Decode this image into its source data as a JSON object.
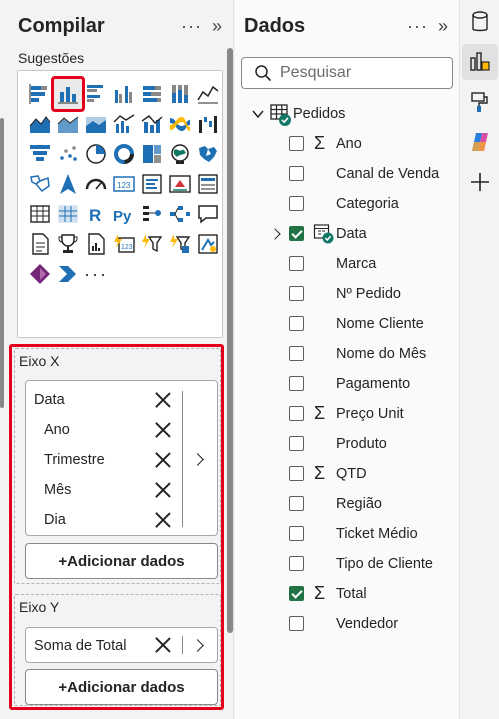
{
  "build_pane": {
    "title": "Compilar",
    "more_glyph": "···",
    "collapse_glyph": "»",
    "suggestions_label": "Sugestões",
    "more_visuals_glyph": "···",
    "x_axis": {
      "label": "Eixo X",
      "fields": [
        "Data",
        "Ano",
        "Trimestre",
        "Mês",
        "Dia"
      ],
      "add_label": "+Adicionar dados"
    },
    "y_axis": {
      "label": "Eixo Y",
      "fields": [
        "Soma de Total"
      ],
      "add_label": "+Adicionar dados"
    }
  },
  "data_pane": {
    "title": "Dados",
    "more_glyph": "···",
    "collapse_glyph": "»",
    "search_placeholder": "Pesquisar",
    "table_name": "Pedidos",
    "fields": [
      {
        "name": "Ano",
        "sigma": true,
        "checked": false
      },
      {
        "name": "Canal de Venda",
        "sigma": false,
        "checked": false
      },
      {
        "name": "Categoria",
        "sigma": false,
        "checked": false
      },
      {
        "name": "Data",
        "sigma": false,
        "checked": true,
        "hierarchy": true
      },
      {
        "name": "Marca",
        "sigma": false,
        "checked": false
      },
      {
        "name": "Nº Pedido",
        "sigma": false,
        "checked": false
      },
      {
        "name": "Nome Cliente",
        "sigma": false,
        "checked": false
      },
      {
        "name": "Nome do Mês",
        "sigma": false,
        "checked": false
      },
      {
        "name": "Pagamento",
        "sigma": false,
        "checked": false
      },
      {
        "name": "Preço Unit",
        "sigma": true,
        "checked": false
      },
      {
        "name": "Produto",
        "sigma": false,
        "checked": false
      },
      {
        "name": "QTD",
        "sigma": true,
        "checked": false
      },
      {
        "name": "Região",
        "sigma": false,
        "checked": false
      },
      {
        "name": "Ticket Médio",
        "sigma": false,
        "checked": false
      },
      {
        "name": "Tipo de Cliente",
        "sigma": false,
        "checked": false
      },
      {
        "name": "Total",
        "sigma": true,
        "checked": true
      },
      {
        "name": "Vendedor",
        "sigma": false,
        "checked": false
      }
    ]
  },
  "colors": {
    "accent_red": "#e3001b",
    "check_green": "#217346",
    "visual_blue": "#1f6fb4"
  }
}
